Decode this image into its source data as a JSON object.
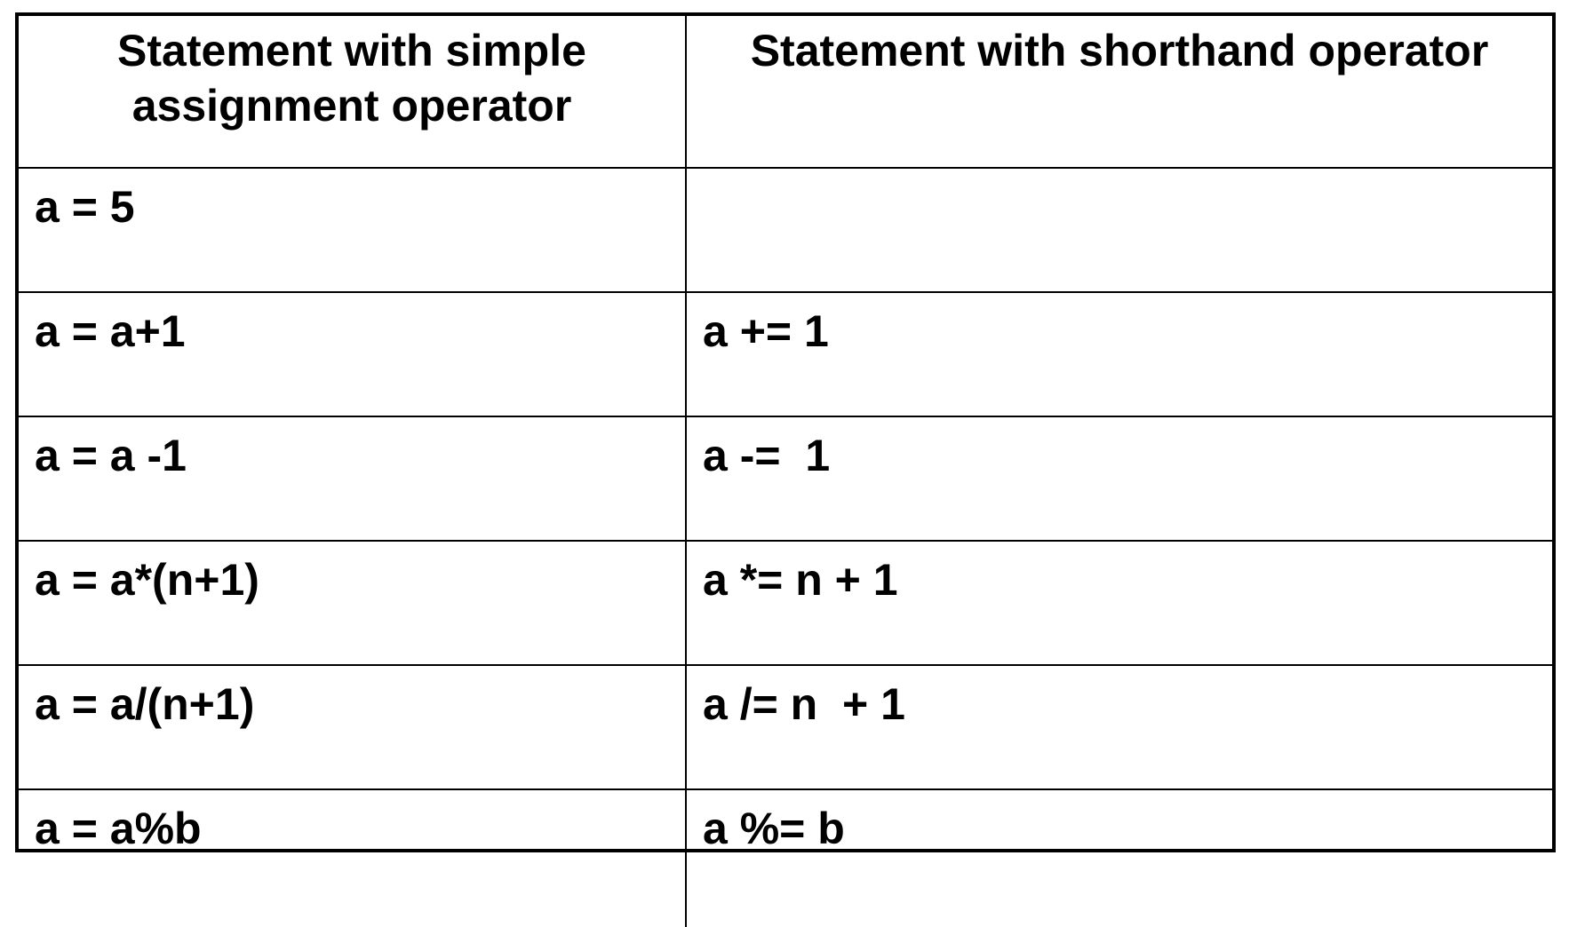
{
  "table": {
    "headers": [
      [
        "Statement with simple",
        "assignment operator"
      ],
      [
        "Statement with shorthand operator"
      ]
    ],
    "rows": [
      [
        "a = 5",
        ""
      ],
      [
        "a = a+1",
        "a += 1"
      ],
      [
        "a = a -1",
        "a -=  1"
      ],
      [
        "a = a*(n+1)",
        "a *= n + 1"
      ],
      [
        "a = a/(n+1)",
        "a /= n  + 1"
      ],
      [
        "a = a%b",
        "a %= b"
      ]
    ]
  }
}
